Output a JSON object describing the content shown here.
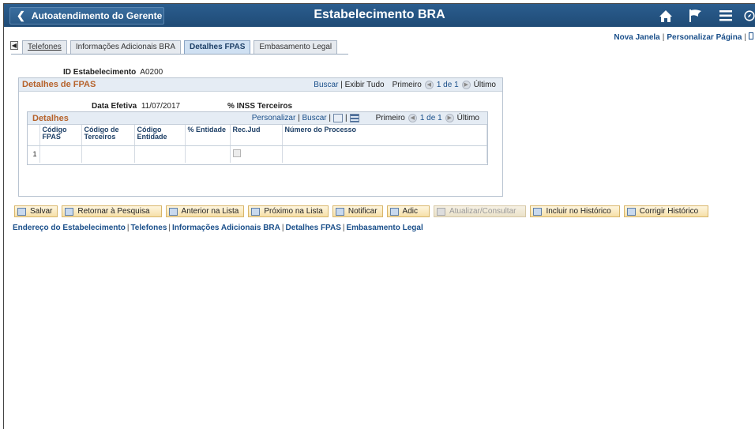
{
  "header": {
    "back_label": "Autoatendimento do Gerente",
    "title": "Estabelecimento BRA",
    "icons": [
      "home-icon",
      "flag-icon",
      "menu-icon",
      "compass-icon"
    ]
  },
  "top_links": {
    "new_window": "Nova Janela",
    "personalize_page": "Personalizar Página"
  },
  "tabs": [
    {
      "label": "Telefones",
      "active": false
    },
    {
      "label": "Informações Adicionais BRA",
      "active": false
    },
    {
      "label": "Detalhes FPAS",
      "active": true
    },
    {
      "label": "Embasamento Legal",
      "active": false
    }
  ],
  "establishment": {
    "label": "ID Estabelecimento",
    "value": "A0200"
  },
  "fpas": {
    "title": "Detalhes de FPAS",
    "find": "Buscar",
    "view_all": "Exibir Tudo",
    "first": "Primeiro",
    "counter": "1 de 1",
    "last": "Último",
    "effective_date_label": "Data Efetiva",
    "effective_date": "11/07/2017",
    "inss_label": "% INSS Terceiros"
  },
  "details": {
    "title": "Detalhes",
    "personalize": "Personalizar",
    "find": "Buscar",
    "first": "Primeiro",
    "counter": "1 de 1",
    "last": "Último",
    "columns": [
      "Código FPAS",
      "Código de Terceiros",
      "Código Entidade",
      "% Entidade",
      "Rec.Jud",
      "Número do Processo"
    ],
    "rows": [
      {
        "num": "1",
        "fpas": "",
        "terceiros": "",
        "entidade": "",
        "pct": "",
        "recjud": false,
        "processo": ""
      }
    ]
  },
  "toolbar": {
    "save": "Salvar",
    "return_search": "Retornar à Pesquisa",
    "prev_list": "Anterior na Lista",
    "next_list": "Próximo na Lista",
    "notify": "Notificar",
    "add": "Adic",
    "update_display": "Atualizar/Consultar",
    "include_history": "Incluir no Histórico",
    "correct_history": "Corrigir Histórico"
  },
  "bottom_links": [
    "Endereço do Estabelecimento",
    "Telefones",
    "Informações Adicionais BRA",
    "Detalhes FPAS",
    "Embasamento Legal"
  ],
  "colors": {
    "header": "#2b5d8e",
    "section_title": "#b6622b",
    "link": "#1a4f8a",
    "button": "#f6dfa8"
  }
}
